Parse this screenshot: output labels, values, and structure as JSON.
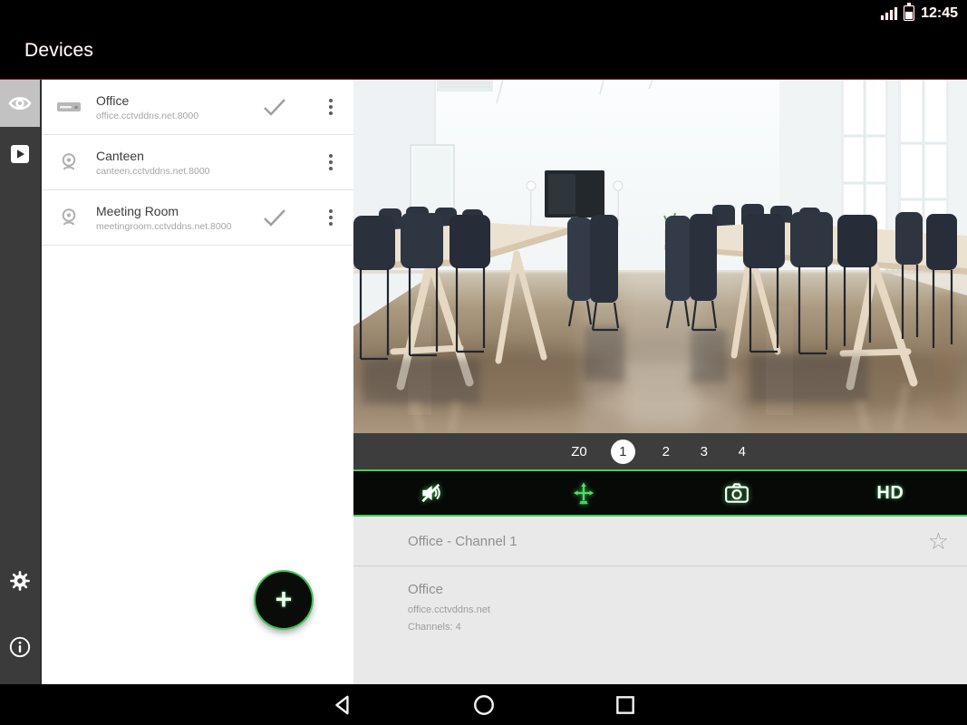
{
  "status_bar": {
    "time": "12:45",
    "icons": [
      "signal-bars-icon",
      "battery-icon"
    ]
  },
  "header": {
    "title": "Devices"
  },
  "nav_rail": {
    "items": [
      {
        "id": "live-view",
        "icon": "eye-icon",
        "selected": true
      },
      {
        "id": "playback",
        "icon": "play-icon",
        "selected": false
      },
      {
        "id": "settings",
        "icon": "gear-icon",
        "selected": false
      },
      {
        "id": "about",
        "icon": "info-icon",
        "selected": false
      }
    ]
  },
  "device_list": {
    "items": [
      {
        "name": "Office",
        "address": "office.cctvddns.net.8000",
        "icon": "dvr-icon",
        "checked": true
      },
      {
        "name": "Canteen",
        "address": "canteen.cctvddns.net.8000",
        "icon": "ip-camera-icon",
        "checked": false
      },
      {
        "name": "Meeting Room",
        "address": "meetingroom.cctvddns.net.8000",
        "icon": "ip-camera-icon",
        "checked": true
      }
    ],
    "add_label": "+"
  },
  "player": {
    "channel_selector": {
      "options": [
        "Z0",
        "1",
        "2",
        "3",
        "4"
      ],
      "selected": "1"
    },
    "toolbar": {
      "accent_color": "#45cd5e",
      "items": [
        {
          "icon": "mute-icon"
        },
        {
          "icon": "ptz-pan-icon"
        },
        {
          "icon": "snapshot-icon"
        },
        {
          "icon": "hd-label",
          "label": "HD"
        }
      ]
    },
    "stream_title": "Office - Channel 1",
    "favorite_glyph": "☆",
    "device_info": {
      "name": "Office",
      "address": "office.cctvddns.net",
      "channels": "Channels: 4"
    }
  },
  "android_nav": {
    "icons": [
      "back-icon",
      "home-icon",
      "recents-icon"
    ]
  },
  "colors": {
    "accent_green": "#45cd5e",
    "rail_bg": "#3b3b3b",
    "header_bg": "#000000",
    "panel_bg": "#e9e9e9"
  }
}
